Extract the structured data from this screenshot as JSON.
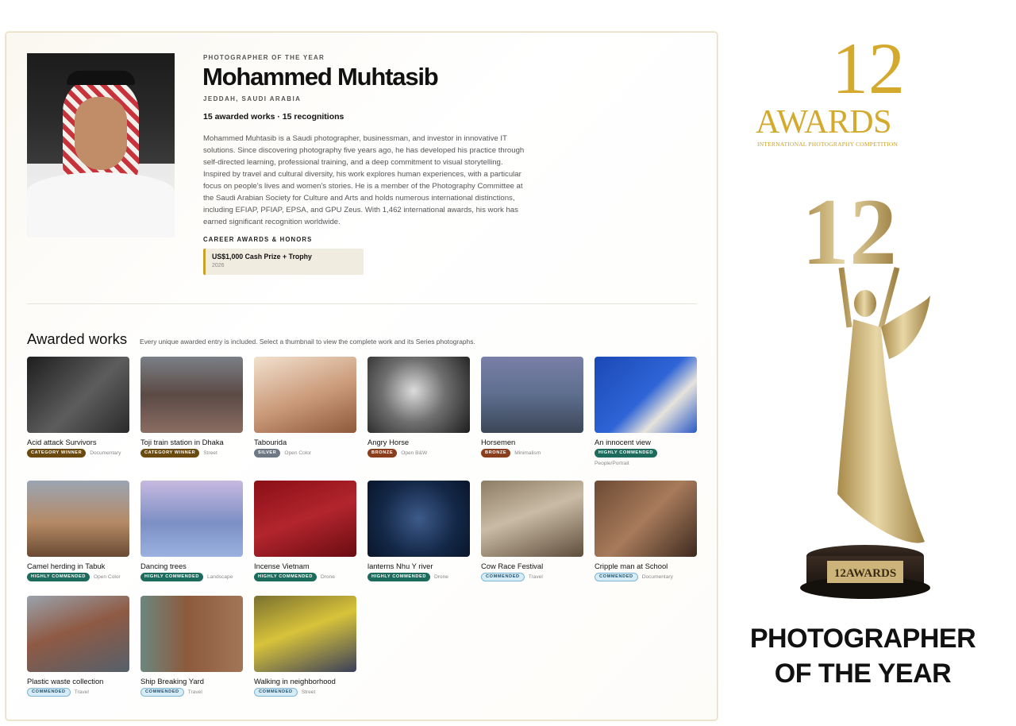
{
  "profile": {
    "eyebrow": "PHOTOGRAPHER OF THE YEAR",
    "name": "Mohammed Muhtasib",
    "location": "JEDDAH, SAUDI ARABIA",
    "stats": "15 awarded works · 15 recognitions",
    "bio": "Mohammed Muhtasib is a Saudi photographer, businessman, and investor in innovative IT solutions. Since discovering photography five years ago, he has developed his practice through self-directed learning, professional training, and a deep commitment to visual storytelling. Inspired by travel and cultural diversity, his work explores human experiences, with a particular focus on people's lives and women's stories. He is a member of the Photography Committee at the Saudi Arabian Society for Culture and Arts and holds numerous international distinctions, including EFIAP, PFIAP, EPSA, and GPU Zeus. With 1,462 international awards, his work has earned significant recognition worldwide.",
    "career_title": "CAREER AWARDS & HONORS",
    "career_award": {
      "title": "US$1,000 Cash Prize + Trophy",
      "year": "2026"
    }
  },
  "works_section": {
    "title": "Awarded works",
    "subtitle": "Every unique awarded entry is included. Select a thumbnail to view the complete work and its Series photographs."
  },
  "badge_colors": {
    "CATEGORY WINNER": "#6b4a10",
    "SILVER": "#6d7884",
    "BRONZE": "#8a3e1e",
    "HIGHLY COMMENDED": "#1c6b5c",
    "COMMENDED": "#d6ecf7"
  },
  "works": [
    {
      "title": "Acid attack Survivors",
      "badge": "CATEGORY WINNER",
      "category": "Documentary",
      "thumb": "linear-gradient(135deg,#1e1e1e,#5d5d5d 55%,#2a2a2a)"
    },
    {
      "title": "Toji train station in Dhaka",
      "badge": "CATEGORY WINNER",
      "category": "Street",
      "thumb": "linear-gradient(180deg,#7a7f86,#5b4a45 50%,#8a6d62)"
    },
    {
      "title": "Tabourida",
      "badge": "SILVER",
      "category": "Open Color",
      "thumb": "linear-gradient(160deg,#f2e1cf,#c99877 55%,#8d5a3b)"
    },
    {
      "title": "Angry Horse",
      "badge": "BRONZE",
      "category": "Open B&W",
      "thumb": "radial-gradient(circle at 45% 45%,#dcdcdc,#6f6f6f 45%,#1d1d1d)"
    },
    {
      "title": "Horsemen",
      "badge": "BRONZE",
      "category": "Minimalism",
      "thumb": "linear-gradient(180deg,#7a7fa8,#5d6e8e 50%,#3c4658)"
    },
    {
      "title": "An innocent view",
      "badge": "HIGHLY COMMENDED",
      "category": "People/Portrait",
      "thumb": "linear-gradient(135deg,#1b49b5,#2e64d6 50%,#e7e3dc 70%,#2a5ac8)"
    },
    {
      "title": "Camel herding in Tabuk",
      "badge": "HIGHLY COMMENDED",
      "category": "Open Color",
      "thumb": "linear-gradient(180deg,#9aa5b2,#b58a66 55%,#6a4a33)"
    },
    {
      "title": "Dancing trees",
      "badge": "HIGHLY COMMENDED",
      "category": "Landscape",
      "thumb": "linear-gradient(180deg,#c7b9e0,#7c8fc4 55%,#9ab2e0)"
    },
    {
      "title": "Incense Vietnam",
      "badge": "HIGHLY COMMENDED",
      "category": "Drone",
      "thumb": "linear-gradient(160deg,#8a0f16,#b3252d 50%,#6a0c12)"
    },
    {
      "title": "lanterns Nhu Y river",
      "badge": "HIGHLY COMMENDED",
      "category": "Drone",
      "thumb": "radial-gradient(circle at 50% 50%,#3d5a8a,#132746 60%,#0a162b)"
    },
    {
      "title": "Cow Race Festival",
      "badge": "COMMENDED",
      "category": "Travel",
      "thumb": "linear-gradient(160deg,#8d7c66,#c9bba5 45%,#5e4d3b)"
    },
    {
      "title": "Cripple man at School",
      "badge": "COMMENDED",
      "category": "Documentary",
      "thumb": "linear-gradient(135deg,#6d4a34,#a77b5b 50%,#3e2a1f)"
    },
    {
      "title": "Plastic waste collection",
      "badge": "COMMENDED",
      "category": "Travel",
      "thumb": "linear-gradient(160deg,#9aa3ad,#8f5a44 45%,#55606b)"
    },
    {
      "title": "Ship Breaking Yard",
      "badge": "COMMENDED",
      "category": "Travel",
      "thumb": "linear-gradient(90deg,#6b8780,#8c5a3c 45%,#a37557)"
    },
    {
      "title": "Walking in neighborhood",
      "badge": "COMMENDED",
      "category": "Street",
      "thumb": "linear-gradient(160deg,#7a7030,#d8c33a 45%,#3a3f5a)"
    }
  ],
  "competition": {
    "logo_number": "12",
    "logo_word": "AWARDS",
    "logo_tagline": "INTERNATIONAL PHOTOGRAPHY COMPETITION",
    "plaque_text": "12AWARDS",
    "headline_line1": "PHOTOGRAPHER",
    "headline_line2": "OF THE YEAR",
    "gold": "#d3a92e"
  }
}
